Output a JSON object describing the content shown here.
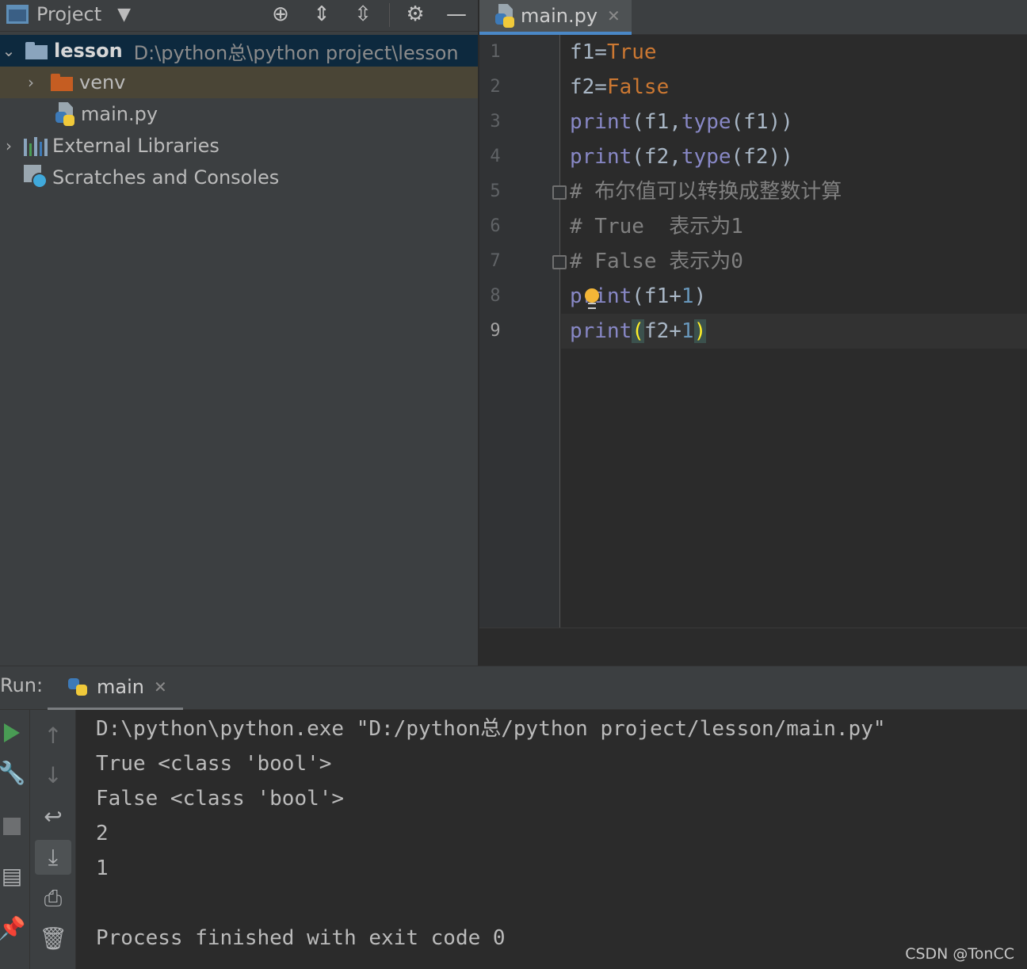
{
  "project_panel": {
    "title": "Project",
    "tree": [
      {
        "label": "lesson",
        "path": "D:\\python总\\python project\\lesson"
      },
      {
        "label": "venv"
      },
      {
        "label": "main.py"
      },
      {
        "label": "External Libraries"
      },
      {
        "label": "Scratches and Consoles"
      }
    ]
  },
  "editor": {
    "tab": "main.py",
    "line_numbers": [
      "1",
      "2",
      "3",
      "4",
      "5",
      "6",
      "7",
      "8",
      "9"
    ],
    "lines": [
      [
        "f1=",
        "True"
      ],
      [
        "f2=",
        "False"
      ],
      [
        "print",
        "(f1,",
        "type",
        "(f1))"
      ],
      [
        "print",
        "(f2,",
        "type",
        "(f2))"
      ],
      [
        "# 布尔值可以转换成整数计算"
      ],
      [
        "# True  表示为1"
      ],
      [
        "# False 表示为0"
      ],
      [
        "print",
        "(f1+",
        "1",
        ")"
      ],
      [
        "print",
        "(",
        "f2+",
        "1",
        ")"
      ]
    ]
  },
  "run_panel": {
    "label": "Run:",
    "tab": "main",
    "output": [
      "D:\\python\\python.exe \"D:/python总/python project/lesson/main.py\"",
      "True <class 'bool'>",
      "False <class 'bool'>",
      "2",
      "1",
      "",
      "Process finished with exit code 0"
    ]
  },
  "watermark": "CSDN @TonCC",
  "colors": {
    "keyword": "#cc7832",
    "builtin": "#8888c6",
    "number": "#6897bb",
    "comment": "#808080",
    "tab_underline": "#4a88c7"
  }
}
